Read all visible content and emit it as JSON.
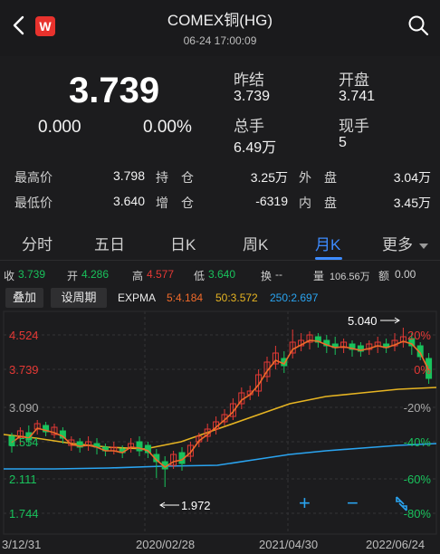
{
  "header": {
    "title": "COMEX铜(HG)",
    "datetime": "06-24 17:00:09",
    "logo_text": "W"
  },
  "quote": {
    "price": "3.739",
    "change": "0.000",
    "change_pct": "0.00%",
    "prev_close_label": "昨结",
    "prev_close": "3.739",
    "open_label": "开盘",
    "open": "3.741",
    "volume_label": "总手",
    "volume": "6.49万",
    "current_label": "现手",
    "current": "5"
  },
  "stats": {
    "high_label": "最高价",
    "high": "3.798",
    "low_label": "最低价",
    "low": "3.640",
    "oi_label": "持　仓",
    "oi": "3.25万",
    "oi_chg_label": "增　仓",
    "oi_chg": "-6319",
    "outer_label": "外　盘",
    "outer": "3.04万",
    "inner_label": "内　盘",
    "inner": "3.45万"
  },
  "tabs": [
    "分时",
    "五日",
    "日K",
    "周K",
    "月K",
    "更多"
  ],
  "active_tab": "月K",
  "info": {
    "close_label": "收",
    "close": "3.739",
    "open_label": "开",
    "open": "4.286",
    "high_label": "高",
    "high": "4.577",
    "low_label": "低",
    "low": "3.640",
    "turn_label": "换",
    "turn": "--",
    "vol_label": "量",
    "vol": "106.56万",
    "amount_label": "额",
    "amount": "0.00"
  },
  "toolbar": {
    "overlay_label": "叠加",
    "period_label": "设周期",
    "indicator": "EXPMA",
    "ema5": "5:4.184",
    "ema50": "50:3.572",
    "ema250": "250:2.697"
  },
  "chart_data": {
    "type": "candlestick",
    "y_ticks": [
      "4.524",
      "3.739",
      "3.090",
      "2.554",
      "2.111",
      "1.744"
    ],
    "pct_ticks": [
      "20%",
      "0%",
      "-20%",
      "-40%",
      "-60%",
      "-80%"
    ],
    "x_ticks": [
      "3/12/31",
      "2020/02/28",
      "2021/04/30",
      "2022/06/24"
    ],
    "max_label": "5.040",
    "min_label": "1.972",
    "colors": {
      "up": "#e53935",
      "down": "#19c25c",
      "ema5": "#f06a2a",
      "ema50": "#e6b422",
      "ema250": "#2aa4f0",
      "grid": "#333336"
    }
  },
  "controls": {
    "zoom_in": "+",
    "zoom_out": "−"
  }
}
